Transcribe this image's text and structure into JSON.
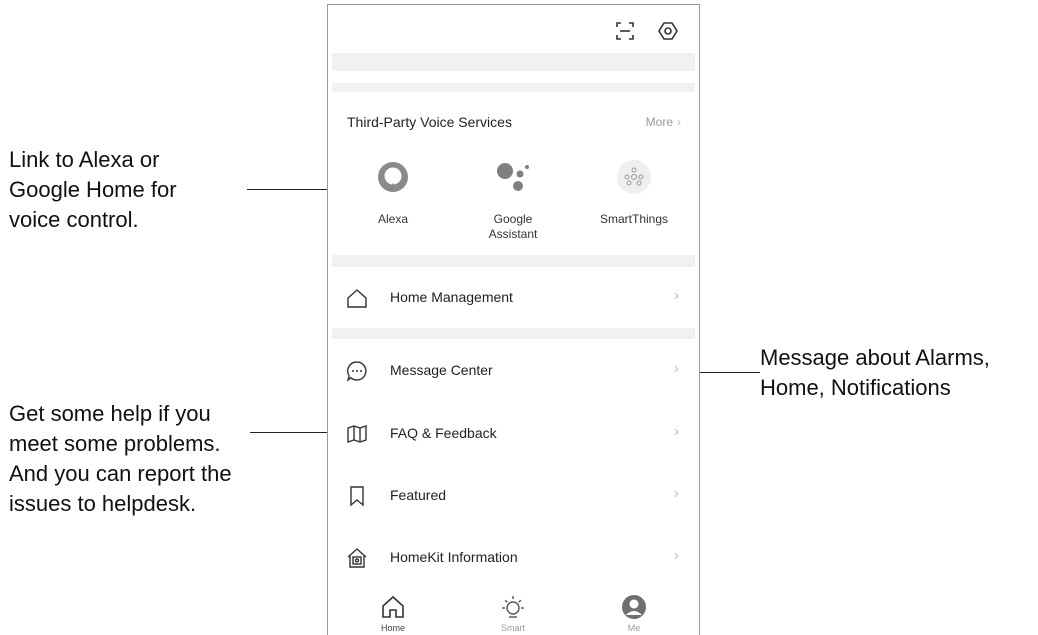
{
  "annotations": {
    "alexa_note": [
      "Link to Alexa or",
      "Google Home for",
      "voice control."
    ],
    "help_note": [
      "Get some help if you",
      "meet some problems.",
      "And you can report the",
      "issues to helpdesk."
    ],
    "message_note": [
      "Message about Alarms,",
      "Home, Notifications"
    ]
  },
  "topbar": {
    "icons": [
      "scan-icon",
      "settings-icon"
    ]
  },
  "voice_services": {
    "title": "Third-Party Voice Services",
    "more_label": "More",
    "items": [
      {
        "label": "Alexa",
        "icon": "alexa-icon"
      },
      {
        "label_line1": "Google",
        "label_line2": "Assistant",
        "icon": "google-assistant-icon"
      },
      {
        "label": "SmartThings",
        "icon": "smartthings-icon"
      }
    ]
  },
  "menu": {
    "home_management": "Home Management",
    "message_center": "Message Center",
    "faq_feedback": "FAQ & Feedback",
    "featured": "Featured",
    "homekit_information": "HomeKit Information"
  },
  "tabbar": {
    "tabs": [
      {
        "label": "Home",
        "icon": "home-icon"
      },
      {
        "label": "Smart",
        "icon": "sun-icon"
      },
      {
        "label": "Me",
        "icon": "user-icon"
      }
    ]
  },
  "colors": {
    "divider": "#f1f1f1",
    "chevron": "#c4c4c4",
    "alexa": "#8a8a8a",
    "google": "#7f7f7f"
  }
}
